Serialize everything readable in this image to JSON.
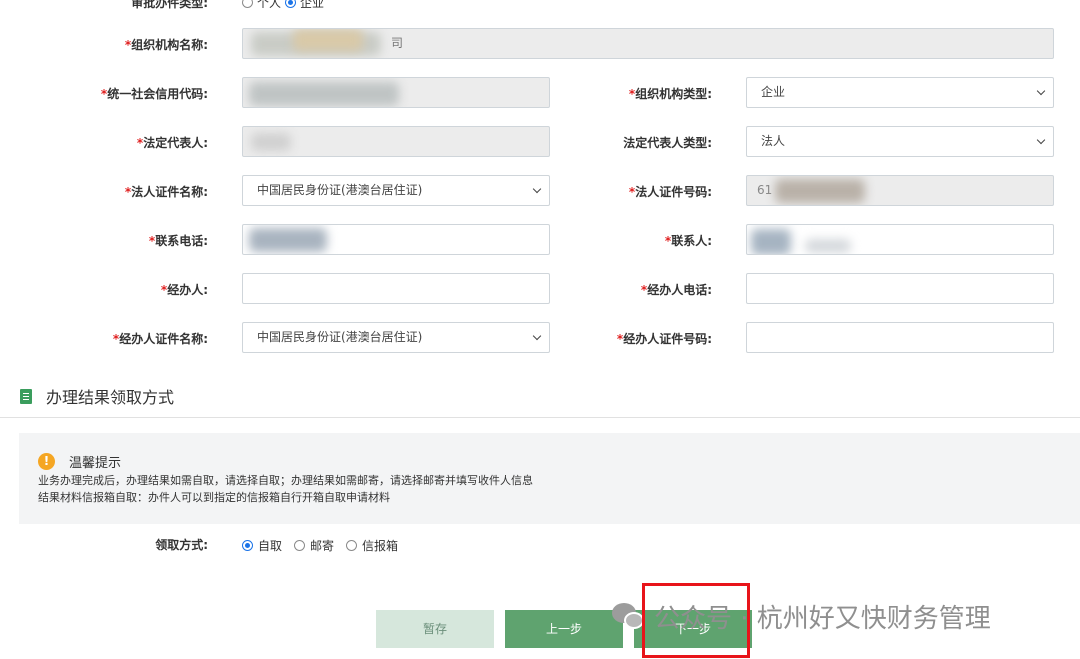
{
  "applicant": {
    "type_label": "审批办件类型:",
    "options": [
      "个人",
      "企业"
    ],
    "selected": "企业"
  },
  "form": {
    "org_name_label": "组织机构名称:",
    "org_name_value": "司",
    "credit_code_label": "统一社会信用代码:",
    "credit_code_value": "",
    "org_type_label": "组织机构类型:",
    "org_type_value": "企业",
    "legal_rep_label": "法定代表人:",
    "legal_rep_value": "",
    "legal_rep_type_label": "法定代表人类型:",
    "legal_rep_type_value": "法人",
    "legal_id_name_label": "法人证件名称:",
    "legal_id_name_value": "中国居民身份证(港澳台居住证)",
    "legal_id_no_label": "法人证件号码:",
    "legal_id_no_value": "61",
    "contact_phone_label": "联系电话:",
    "contact_label": "联系人:",
    "handler_label": "经办人:",
    "handler_phone_label": "经办人电话:",
    "handler_id_name_label": "经办人证件名称:",
    "handler_id_name_value": "中国居民身份证(港澳台居住证)",
    "handler_id_no_label": "经办人证件号码:",
    "required_mark": "*"
  },
  "result_section": {
    "title": "办理结果领取方式",
    "tip_title": "温馨提示",
    "tip_icon": "!",
    "tip_line1": "业务办理完成后，办理结果如需自取，请选择自取；办理结果如需邮寄，请选择邮寄并填写收件人信息",
    "tip_line2": "结果材料信报箱自取：办件人可以到指定的信报箱自行开箱自取申请材料",
    "pickup_label": "领取方式:",
    "pickup_options": [
      "自取",
      "邮寄",
      "信报箱"
    ],
    "pickup_selected": "自取"
  },
  "buttons": {
    "save": "暂存",
    "prev": "上一步",
    "next": "下一步"
  },
  "watermark": {
    "text": "公众号 · 杭州好又快财务管理"
  },
  "colors": {
    "required": "#e02020",
    "primary_button": "#5fa36f",
    "disabled_button": "#d6e7dc",
    "highlight_box": "#e8141a",
    "radio_selected": "#1a73e8",
    "tip_icon": "#f5a623"
  }
}
